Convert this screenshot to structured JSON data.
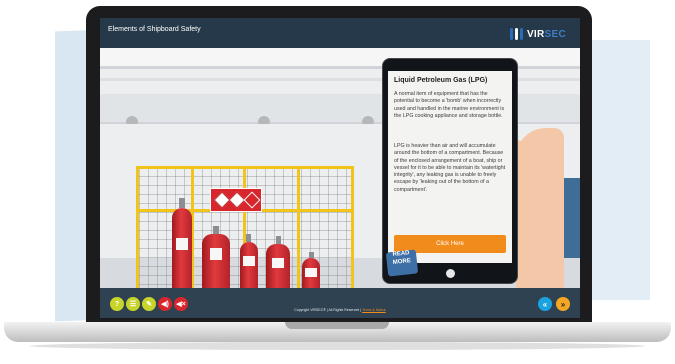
{
  "header": {
    "course_title": "Elements of Shipboard Safety",
    "logo": {
      "brand_a": "VIR",
      "brand_b": "SEC",
      "icon": "virsec-logo-mark"
    }
  },
  "tablet": {
    "title": "Liquid Petroleum Gas (LPG)",
    "paragraph1": "A normal item of equipment that has the potential to become a 'bomb' when incorrectly used and handled in the marine environment is the LPG cooking appliance and storage bottle.",
    "paragraph2": "LPG is heavier than air and will accumulate around the bottom of a compartment. Because of the enclosed arrangement of a boat, ship or vessel for it to be able to maintain its 'watertight integrity', any leaking gas is unable to freely escape by 'leaking out of the bottom of a compartment'.",
    "button_label": "Click Here"
  },
  "read_more": {
    "line1": "READ",
    "line2": "MORE"
  },
  "controls": [
    {
      "name": "help-button",
      "glyph": "?",
      "icon": "question-icon",
      "color": "#c9d42a"
    },
    {
      "name": "menu-button",
      "glyph": "☰",
      "icon": "list-icon",
      "color": "#c9d42a"
    },
    {
      "name": "notes-button",
      "glyph": "✎",
      "icon": "pencil-icon",
      "color": "#c9d42a"
    },
    {
      "name": "audio-button",
      "glyph": "◀)",
      "icon": "speaker-icon",
      "color": "#d8262d"
    },
    {
      "name": "mute-button",
      "glyph": "◀×",
      "icon": "speaker-mute-icon",
      "color": "#d8262d"
    }
  ],
  "nav": {
    "back": {
      "glyph": "«",
      "icon": "back-icon",
      "color": "#1aa3e0"
    },
    "next": {
      "glyph": "»",
      "icon": "next-icon",
      "color": "#f5a623"
    }
  },
  "footer": {
    "copyright": "Copyright VIRSEC® | All Rights Reserved |",
    "link": "Terms & Notice"
  }
}
